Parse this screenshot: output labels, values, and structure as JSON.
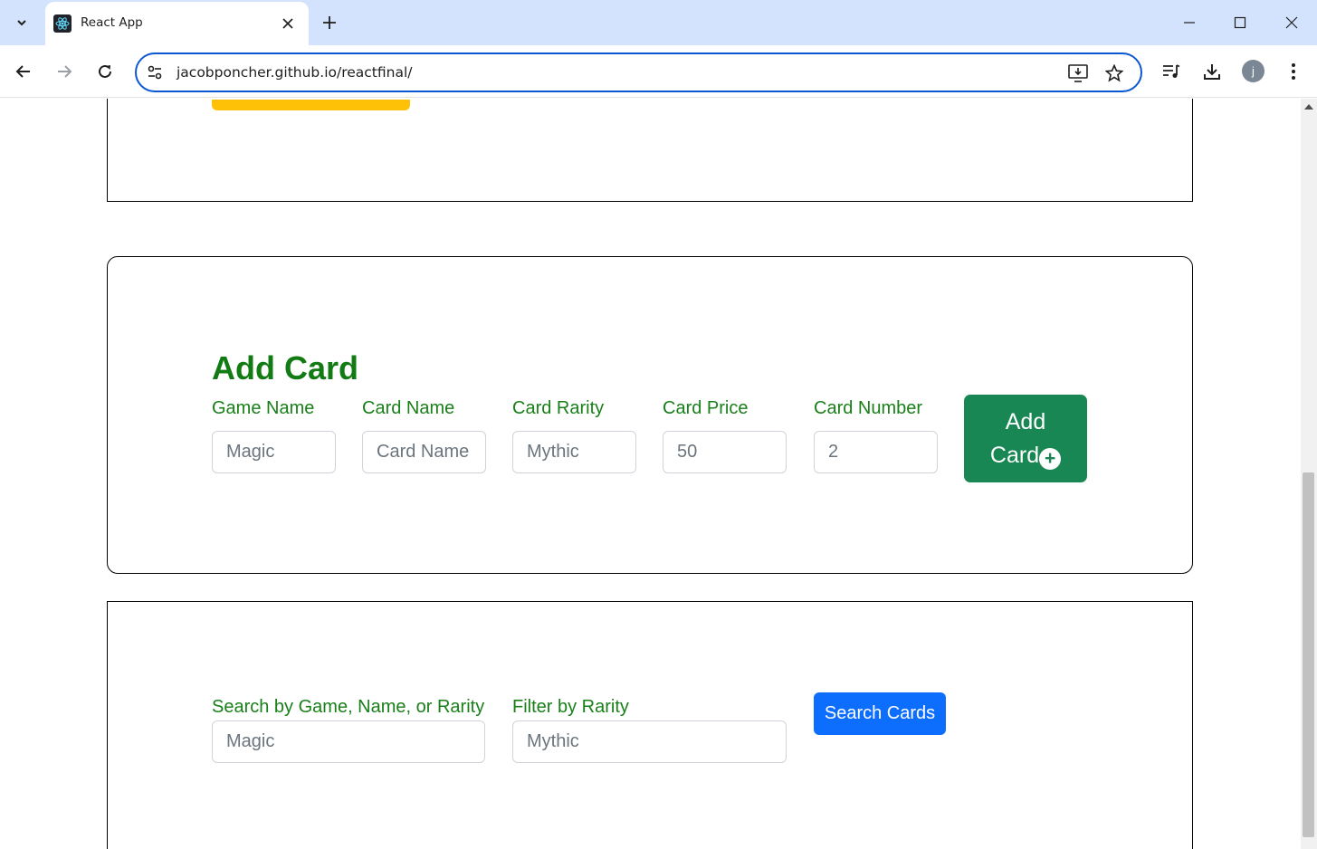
{
  "browser": {
    "tab_title": "React App",
    "url": "jacobponcher.github.io/reactfinal/",
    "profile_initial": "j"
  },
  "add_card": {
    "title": "Add Card",
    "fields": [
      {
        "label": "Game Name",
        "placeholder": "Magic"
      },
      {
        "label": "Card Name",
        "placeholder": "Card Name"
      },
      {
        "label": "Card Rarity",
        "placeholder": "Mythic"
      },
      {
        "label": "Card Price",
        "placeholder": "50"
      },
      {
        "label": "Card Number",
        "placeholder": "2"
      }
    ],
    "button_line1": "Add",
    "button_line2": "Card"
  },
  "search": {
    "search_label": "Search by Game, Name, or Rarity",
    "search_placeholder": "Magic",
    "filter_label": "Filter by Rarity",
    "filter_placeholder": "Mythic",
    "button_label": "Search Cards"
  },
  "colors": {
    "accent_green": "#198754",
    "title_green": "#137b13",
    "search_blue": "#0d6efd",
    "warning_yellow": "#ffc107",
    "chrome_blue": "#d3e3fd"
  }
}
